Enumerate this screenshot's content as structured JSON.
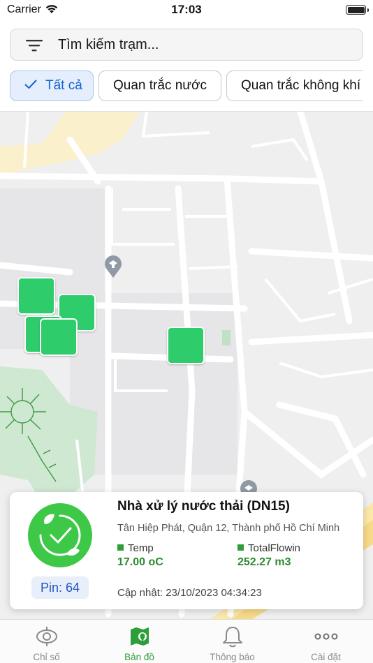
{
  "status_bar": {
    "carrier": "Carrier",
    "time": "17:03"
  },
  "search": {
    "placeholder": "Tìm kiếm trạm..."
  },
  "filters": [
    {
      "label": "Tất cả",
      "selected": true
    },
    {
      "label": "Quan trắc nước",
      "selected": false
    },
    {
      "label": "Quan trắc không khí",
      "selected": false
    }
  ],
  "map": {
    "marker_color": "#2ecc6a",
    "stations_visible": 5
  },
  "station_card": {
    "title": "Nhà xử lý nước thải (DN15)",
    "address": "Tân Hiệp Phát, Quận 12, Thành phố Hồ Chí Minh",
    "battery": "Pin: 64",
    "sensors": [
      {
        "name": "Temp",
        "value": "17.00 oC"
      },
      {
        "name": "TotalFlowin",
        "value": "252.27 m3"
      }
    ],
    "updated": "Cập nhật: 23/10/2023 04:34:23",
    "logo_icon": "leaf-check-icon"
  },
  "tabs": [
    {
      "label": "Chỉ số",
      "icon": "sensor-icon",
      "active": false
    },
    {
      "label": "Bản đồ",
      "icon": "map-pin-icon",
      "active": true
    },
    {
      "label": "Thông báo",
      "icon": "bell-icon",
      "active": false
    },
    {
      "label": "Cài đặt",
      "icon": "more-icon",
      "active": false
    }
  ],
  "colors": {
    "accent_blue": "#1663d6",
    "accent_green": "#2e9e3a",
    "marker_green": "#2ecc6a"
  }
}
